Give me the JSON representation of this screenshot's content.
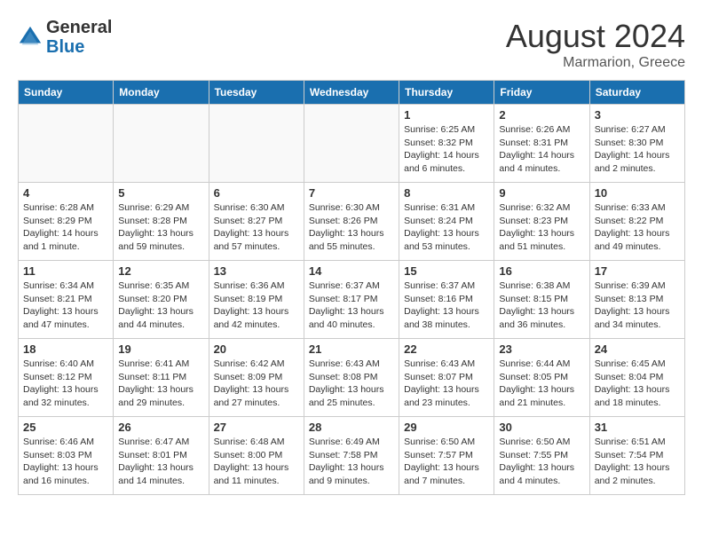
{
  "header": {
    "logo_general": "General",
    "logo_blue": "Blue",
    "month_year": "August 2024",
    "location": "Marmarion, Greece"
  },
  "weekdays": [
    "Sunday",
    "Monday",
    "Tuesday",
    "Wednesday",
    "Thursday",
    "Friday",
    "Saturday"
  ],
  "weeks": [
    [
      {
        "day": "",
        "info": ""
      },
      {
        "day": "",
        "info": ""
      },
      {
        "day": "",
        "info": ""
      },
      {
        "day": "",
        "info": ""
      },
      {
        "day": "1",
        "info": "Sunrise: 6:25 AM\nSunset: 8:32 PM\nDaylight: 14 hours\nand 6 minutes."
      },
      {
        "day": "2",
        "info": "Sunrise: 6:26 AM\nSunset: 8:31 PM\nDaylight: 14 hours\nand 4 minutes."
      },
      {
        "day": "3",
        "info": "Sunrise: 6:27 AM\nSunset: 8:30 PM\nDaylight: 14 hours\nand 2 minutes."
      }
    ],
    [
      {
        "day": "4",
        "info": "Sunrise: 6:28 AM\nSunset: 8:29 PM\nDaylight: 14 hours\nand 1 minute."
      },
      {
        "day": "5",
        "info": "Sunrise: 6:29 AM\nSunset: 8:28 PM\nDaylight: 13 hours\nand 59 minutes."
      },
      {
        "day": "6",
        "info": "Sunrise: 6:30 AM\nSunset: 8:27 PM\nDaylight: 13 hours\nand 57 minutes."
      },
      {
        "day": "7",
        "info": "Sunrise: 6:30 AM\nSunset: 8:26 PM\nDaylight: 13 hours\nand 55 minutes."
      },
      {
        "day": "8",
        "info": "Sunrise: 6:31 AM\nSunset: 8:24 PM\nDaylight: 13 hours\nand 53 minutes."
      },
      {
        "day": "9",
        "info": "Sunrise: 6:32 AM\nSunset: 8:23 PM\nDaylight: 13 hours\nand 51 minutes."
      },
      {
        "day": "10",
        "info": "Sunrise: 6:33 AM\nSunset: 8:22 PM\nDaylight: 13 hours\nand 49 minutes."
      }
    ],
    [
      {
        "day": "11",
        "info": "Sunrise: 6:34 AM\nSunset: 8:21 PM\nDaylight: 13 hours\nand 47 minutes."
      },
      {
        "day": "12",
        "info": "Sunrise: 6:35 AM\nSunset: 8:20 PM\nDaylight: 13 hours\nand 44 minutes."
      },
      {
        "day": "13",
        "info": "Sunrise: 6:36 AM\nSunset: 8:19 PM\nDaylight: 13 hours\nand 42 minutes."
      },
      {
        "day": "14",
        "info": "Sunrise: 6:37 AM\nSunset: 8:17 PM\nDaylight: 13 hours\nand 40 minutes."
      },
      {
        "day": "15",
        "info": "Sunrise: 6:37 AM\nSunset: 8:16 PM\nDaylight: 13 hours\nand 38 minutes."
      },
      {
        "day": "16",
        "info": "Sunrise: 6:38 AM\nSunset: 8:15 PM\nDaylight: 13 hours\nand 36 minutes."
      },
      {
        "day": "17",
        "info": "Sunrise: 6:39 AM\nSunset: 8:13 PM\nDaylight: 13 hours\nand 34 minutes."
      }
    ],
    [
      {
        "day": "18",
        "info": "Sunrise: 6:40 AM\nSunset: 8:12 PM\nDaylight: 13 hours\nand 32 minutes."
      },
      {
        "day": "19",
        "info": "Sunrise: 6:41 AM\nSunset: 8:11 PM\nDaylight: 13 hours\nand 29 minutes."
      },
      {
        "day": "20",
        "info": "Sunrise: 6:42 AM\nSunset: 8:09 PM\nDaylight: 13 hours\nand 27 minutes."
      },
      {
        "day": "21",
        "info": "Sunrise: 6:43 AM\nSunset: 8:08 PM\nDaylight: 13 hours\nand 25 minutes."
      },
      {
        "day": "22",
        "info": "Sunrise: 6:43 AM\nSunset: 8:07 PM\nDaylight: 13 hours\nand 23 minutes."
      },
      {
        "day": "23",
        "info": "Sunrise: 6:44 AM\nSunset: 8:05 PM\nDaylight: 13 hours\nand 21 minutes."
      },
      {
        "day": "24",
        "info": "Sunrise: 6:45 AM\nSunset: 8:04 PM\nDaylight: 13 hours\nand 18 minutes."
      }
    ],
    [
      {
        "day": "25",
        "info": "Sunrise: 6:46 AM\nSunset: 8:03 PM\nDaylight: 13 hours\nand 16 minutes."
      },
      {
        "day": "26",
        "info": "Sunrise: 6:47 AM\nSunset: 8:01 PM\nDaylight: 13 hours\nand 14 minutes."
      },
      {
        "day": "27",
        "info": "Sunrise: 6:48 AM\nSunset: 8:00 PM\nDaylight: 13 hours\nand 11 minutes."
      },
      {
        "day": "28",
        "info": "Sunrise: 6:49 AM\nSunset: 7:58 PM\nDaylight: 13 hours\nand 9 minutes."
      },
      {
        "day": "29",
        "info": "Sunrise: 6:50 AM\nSunset: 7:57 PM\nDaylight: 13 hours\nand 7 minutes."
      },
      {
        "day": "30",
        "info": "Sunrise: 6:50 AM\nSunset: 7:55 PM\nDaylight: 13 hours\nand 4 minutes."
      },
      {
        "day": "31",
        "info": "Sunrise: 6:51 AM\nSunset: 7:54 PM\nDaylight: 13 hours\nand 2 minutes."
      }
    ]
  ]
}
